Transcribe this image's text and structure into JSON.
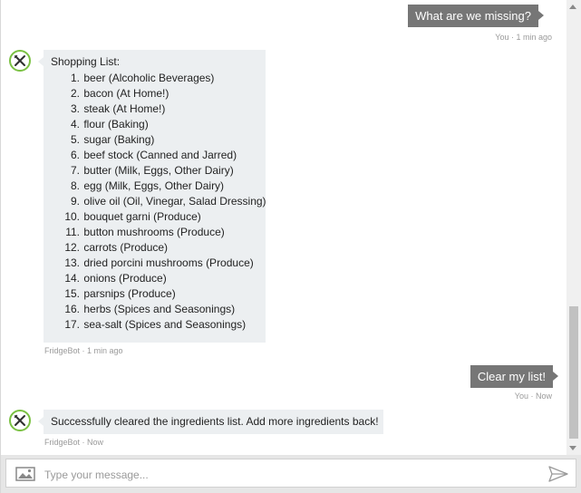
{
  "messages": [
    {
      "sender": "user",
      "text": "What are we missing?",
      "meta": "You · 1 min ago"
    },
    {
      "sender": "bot",
      "list_title": "Shopping List:",
      "items": [
        {
          "num": "1.",
          "text": "beer (Alcoholic Beverages)"
        },
        {
          "num": "2.",
          "text": "bacon (At Home!)"
        },
        {
          "num": "3.",
          "text": "steak (At Home!)"
        },
        {
          "num": "4.",
          "text": "flour (Baking)"
        },
        {
          "num": "5.",
          "text": "sugar (Baking)"
        },
        {
          "num": "6.",
          "text": "beef stock (Canned and Jarred)"
        },
        {
          "num": "7.",
          "text": "butter (Milk, Eggs, Other Dairy)"
        },
        {
          "num": "8.",
          "text": "egg (Milk, Eggs, Other Dairy)"
        },
        {
          "num": "9.",
          "text": "olive oil (Oil, Vinegar, Salad Dressing)"
        },
        {
          "num": "10.",
          "text": "bouquet garni (Produce)"
        },
        {
          "num": "11.",
          "text": "button mushrooms (Produce)"
        },
        {
          "num": "12.",
          "text": "carrots (Produce)"
        },
        {
          "num": "13.",
          "text": "dried porcini mushrooms (Produce)"
        },
        {
          "num": "14.",
          "text": "onions (Produce)"
        },
        {
          "num": "15.",
          "text": "parsnips (Produce)"
        },
        {
          "num": "16.",
          "text": "herbs (Spices and Seasonings)"
        },
        {
          "num": "17.",
          "text": "sea-salt (Spices and Seasonings)"
        }
      ],
      "meta": "FridgeBot · 1 min ago"
    },
    {
      "sender": "user",
      "text": "Clear my list!",
      "meta": "You · Now"
    },
    {
      "sender": "bot",
      "text": "Successfully cleared the ingredients list. Add more ingredients back!",
      "meta": "FridgeBot · Now"
    }
  ],
  "composer": {
    "placeholder": "Type your message...",
    "image_icon": "image-icon",
    "send_icon": "send-icon"
  },
  "colors": {
    "user_bubble": "#767676",
    "bot_bubble": "#eceff1",
    "avatar_ring": "#7ac142",
    "meta_text": "#9a9a9a"
  }
}
